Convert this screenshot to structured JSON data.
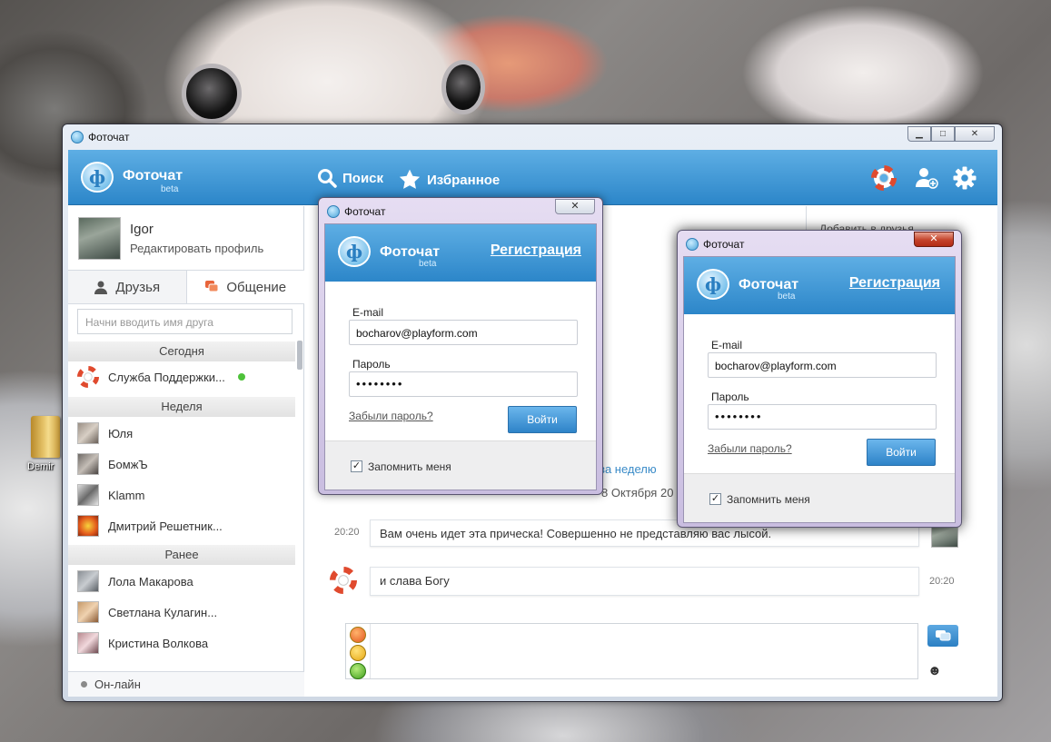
{
  "desktop": {
    "icon_label": "Demir"
  },
  "window": {
    "title": "Фоточат",
    "controls": {
      "minimize": "▁",
      "maximize": "□",
      "close": "✕"
    }
  },
  "app": {
    "logo_text": "Фоточат",
    "logo_beta": "beta",
    "nav": {
      "search": "Поиск",
      "favorites": "Избранное"
    },
    "tools": [
      "lifebuoy-icon",
      "add-friend-icon",
      "gear-icon"
    ]
  },
  "sidebar": {
    "profile": {
      "name": "Igor",
      "edit": "Редактировать профиль"
    },
    "tabs": {
      "friends": "Друзья",
      "chat": "Общение"
    },
    "search_placeholder": "Начни вводить имя друга",
    "sections": {
      "today": "Сегодня",
      "week": "Неделя",
      "earlier": "Ранее"
    },
    "today": [
      {
        "name": "Служба Поддержки..."
      }
    ],
    "week": [
      {
        "name": "Юля"
      },
      {
        "name": "БомжЪ"
      },
      {
        "name": "Klamm"
      },
      {
        "name": "Дмитрий Решетник..."
      }
    ],
    "earlier": [
      {
        "name": "Лола Макарова"
      },
      {
        "name": "Светлана Кулагин..."
      },
      {
        "name": "Кристина Волкова"
      }
    ],
    "footer_status": "Он-лайн"
  },
  "chat": {
    "header_right": "Добавить в друзья",
    "filter_partial": "за неделю",
    "date_partial": "8 Октября 20",
    "messages": [
      {
        "time": "20:20",
        "text": "Вам очень идет эта прическа! Совершенно не представляю вас лысой."
      },
      {
        "time": "20:20",
        "text": "и слава Богу"
      }
    ]
  },
  "login_dialogs": [
    {
      "title": "Фоточат",
      "close": "✕",
      "logo_text": "Фоточат",
      "logo_beta": "beta",
      "register": "Регистрация",
      "email_label": "E-mail",
      "email_value": "bocharov@playform.com",
      "password_label": "Пароль",
      "password_value": "••••••••",
      "forgot": "Забыли пароль?",
      "login_button": "Войти",
      "remember": "Запомнить меня",
      "remember_checked": true
    },
    {
      "title": "Фоточат",
      "close": "✕",
      "logo_text": "Фоточат",
      "logo_beta": "beta",
      "register": "Регистрация",
      "email_label": "E-mail",
      "email_value": "bocharov@playform.com",
      "password_label": "Пароль",
      "password_value": "••••••••",
      "forgot": "Забыли пароль?",
      "login_button": "Войти",
      "remember": "Запомнить меня",
      "remember_checked": true
    }
  ],
  "colors": {
    "accent": "#2c86c9",
    "online": "#4ec23a",
    "dialog_frame": "#c9bde0"
  }
}
